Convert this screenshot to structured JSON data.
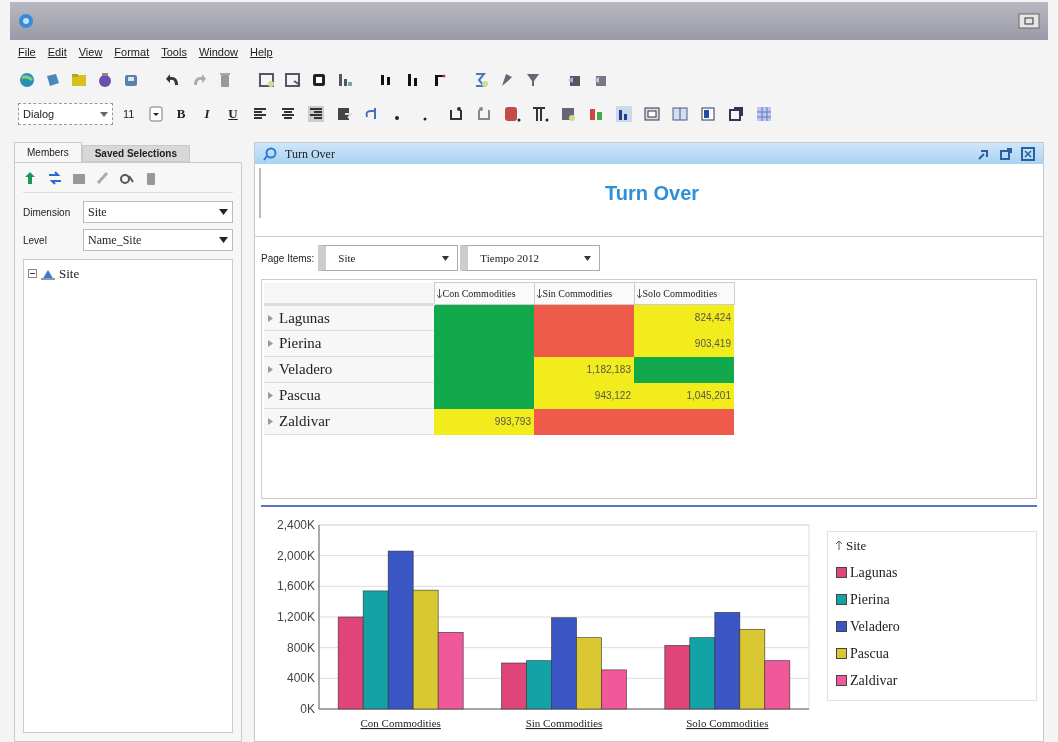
{
  "menu": [
    "File",
    "Edit",
    "View",
    "Format",
    "Tools",
    "Window",
    "Help"
  ],
  "format_toolbar": {
    "font": "Dialog",
    "size": "11",
    "style_buttons": [
      {
        "label": "B",
        "kind": "bold"
      },
      {
        "label": "I",
        "kind": "italic"
      },
      {
        "label": "U",
        "kind": "underline"
      }
    ]
  },
  "left_panel": {
    "tabs": [
      {
        "label": "Members",
        "selected": true
      },
      {
        "label": "Saved Selections",
        "selected": false
      }
    ],
    "fields": [
      {
        "label": "Dimension",
        "value": "Site"
      },
      {
        "label": "Level",
        "value": "Name_Site"
      }
    ],
    "tree": [
      {
        "label": "Site",
        "expanded": true
      }
    ]
  },
  "report": {
    "window_title": "Turn Over",
    "title": "Turn Over",
    "page_items_label": "Page Items:",
    "page_items": [
      "Site",
      "Tiempo 2012"
    ],
    "table": {
      "columns": [
        "Con Commodities",
        "Sin Commodities",
        "Solo Commodities"
      ],
      "rows": [
        {
          "label": "Lagunas",
          "cells": [
            {
              "color": "#12a84c"
            },
            {
              "color": "#ef5b4b"
            },
            {
              "value": "824,424",
              "color": "#f2ec1c"
            }
          ]
        },
        {
          "label": "Pierina",
          "cells": [
            {
              "color": "#12a84c"
            },
            {
              "color": "#ef5b4b"
            },
            {
              "value": "903,419",
              "color": "#f2ec1c"
            }
          ]
        },
        {
          "label": "Veladero",
          "cells": [
            {
              "color": "#12a84c"
            },
            {
              "value": "1,182,183",
              "color": "#f2ec1c"
            },
            {
              "color": "#12a84c"
            }
          ]
        },
        {
          "label": "Pascua",
          "cells": [
            {
              "color": "#12a84c"
            },
            {
              "value": "943,122",
              "color": "#f2ec1c"
            },
            {
              "value": "1,045,201",
              "color": "#f2ec1c"
            }
          ]
        },
        {
          "label": "Zaldivar",
          "cells": [
            {
              "value": "993,793",
              "color": "#f2ec1c"
            },
            {
              "color": "#ef5b4b"
            },
            {
              "color": "#ef5b4b"
            }
          ]
        }
      ]
    },
    "chart": {
      "legend_title": "Site",
      "chart_data": {
        "type": "bar",
        "grid": true,
        "categories": [
          "Con Commodities",
          "Sin Commodities",
          "Solo Commodities"
        ],
        "ylim": [
          0,
          2400
        ],
        "yticks": [
          {
            "value": 0,
            "label": "0K"
          },
          {
            "value": 400,
            "label": "400K"
          },
          {
            "value": 800,
            "label": "800K"
          },
          {
            "value": 1200,
            "label": "1,200K"
          },
          {
            "value": 1600,
            "label": "1,600K"
          },
          {
            "value": 2000,
            "label": "2,000K"
          },
          {
            "value": 2400,
            "label": "2,400K"
          }
        ],
        "series": [
          {
            "name": "Lagunas",
            "color": "#e0457a",
            "values": [
              1200,
              600,
              830
            ]
          },
          {
            "name": "Pierina",
            "color": "#13a3a6",
            "values": [
              1540,
              630,
              930
            ]
          },
          {
            "name": "Veladero",
            "color": "#3a56c4",
            "values": [
              2060,
              1190,
              1260
            ]
          },
          {
            "name": "Pascua",
            "color": "#d9c831",
            "values": [
              1550,
              930,
              1040
            ]
          },
          {
            "name": "Zaldivar",
            "color": "#f0589a",
            "values": [
              1000,
              510,
              630
            ]
          }
        ]
      }
    }
  }
}
